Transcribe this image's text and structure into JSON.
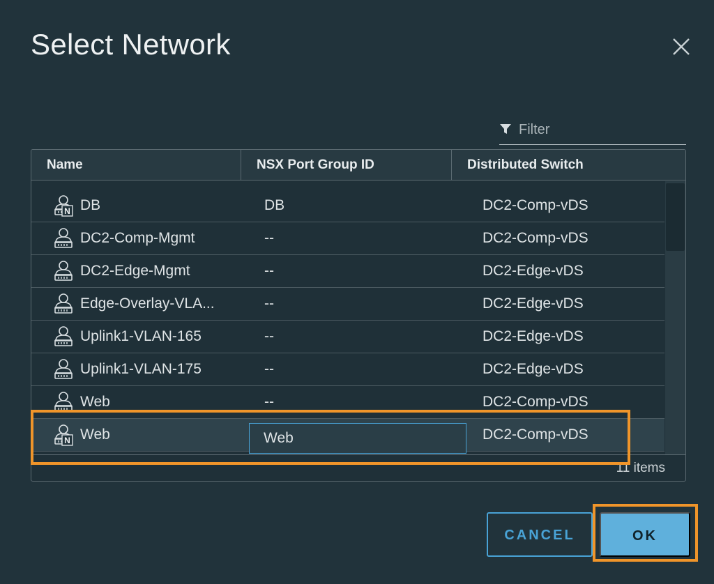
{
  "dialog": {
    "title": "Select Network"
  },
  "filter": {
    "placeholder": "Filter"
  },
  "grid": {
    "columns": [
      "Name",
      "NSX Port Group ID",
      "Distributed Switch"
    ],
    "rows": [
      {
        "icon": "nsx-network-icon",
        "name": "DB",
        "nsx": "DB",
        "ds": "DC2-Comp-vDS"
      },
      {
        "icon": "network-icon",
        "name": "DC2-Comp-Mgmt",
        "nsx": "--",
        "ds": "DC2-Comp-vDS"
      },
      {
        "icon": "network-icon",
        "name": "DC2-Edge-Mgmt",
        "nsx": "--",
        "ds": "DC2-Edge-vDS"
      },
      {
        "icon": "network-icon",
        "name": "Edge-Overlay-VLA...",
        "nsx": "--",
        "ds": "DC2-Edge-vDS"
      },
      {
        "icon": "network-icon",
        "name": "Uplink1-VLAN-165",
        "nsx": "--",
        "ds": "DC2-Edge-vDS"
      },
      {
        "icon": "network-icon",
        "name": "Uplink1-VLAN-175",
        "nsx": "--",
        "ds": "DC2-Edge-vDS"
      },
      {
        "icon": "network-icon",
        "name": "Web",
        "nsx": "--",
        "ds": "DC2-Comp-vDS"
      },
      {
        "icon": "nsx-network-icon",
        "name": "Web",
        "nsx": "Web",
        "ds": "DC2-Comp-vDS",
        "selected": true
      }
    ],
    "footer": "11 items"
  },
  "buttons": {
    "cancel": "CANCEL",
    "ok": "OK"
  },
  "colors": {
    "background": "#21333b",
    "accent": "#49a3d6",
    "primary_button": "#5fb0dc",
    "highlight": "#f0952a"
  }
}
